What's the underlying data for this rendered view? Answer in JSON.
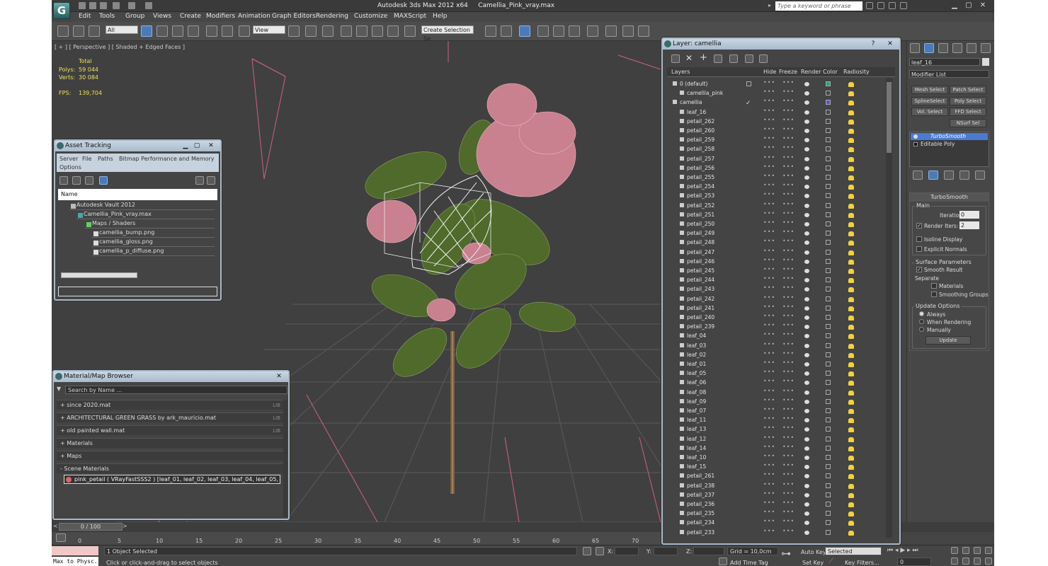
{
  "app": {
    "title": "Autodesk 3ds Max  2012 x64",
    "file": "Camellia_Pink_vray.max",
    "search_placeholder": "Type a keyword or phrase",
    "logo": "G"
  },
  "menu": [
    "Edit",
    "Tools",
    "Group",
    "Views",
    "Create",
    "Modifiers",
    "Animation",
    "Graph Editors",
    "Rendering",
    "Customize",
    "MAXScript",
    "Help"
  ],
  "toolbar": {
    "filter": "All",
    "refcoord": "View",
    "selset": "Create Selection Se"
  },
  "viewport": {
    "label": "[ + ] [ Perspective ] [ Shaded + Edged Faces ]",
    "stats": {
      "total": "Total",
      "polys_label": "Polys:",
      "polys": "59 044",
      "verts_label": "Verts:",
      "verts": "30 084",
      "fps_label": "FPS:",
      "fps": "139,704"
    }
  },
  "asset_tracking": {
    "title": "Asset Tracking",
    "menu": [
      "Server",
      "File",
      "Paths",
      "Bitmap Performance and Memory"
    ],
    "menu2": "Options",
    "column": "Name",
    "rows": [
      "Autodesk Vault 2012",
      "Camellia_Pink_vray.max",
      "Maps / Shaders",
      "camellia_bump.png",
      "camellia_gloss.png",
      "camellia_p_diffuse.png"
    ]
  },
  "material_browser": {
    "title": "Material/Map Browser",
    "search": "Search by Name ...",
    "items": [
      {
        "label": "+ since 2020.mat",
        "tag": "LIB"
      },
      {
        "label": "+ ARCHITECTURAL GREEN GRASS by ark_mauricio.mat",
        "tag": "LIB"
      },
      {
        "label": "+ old painted wall.mat",
        "tag": "LIB"
      },
      {
        "label": "+ Materials",
        "tag": ""
      },
      {
        "label": "+ Maps",
        "tag": ""
      },
      {
        "label": "- Scene Materials",
        "tag": ""
      }
    ],
    "material": "pink_petail  ( VRayFastSSS2 )  [leaf_01, leaf_02, leaf_03, leaf_04, leaf_05, leaf_0..."
  },
  "layer_manager": {
    "title": "Layer: camellia",
    "columns": [
      "Layers",
      "Hide",
      "Freeze",
      "Render",
      "Color",
      "Radiosity"
    ],
    "layers": [
      {
        "name": "0 (default)",
        "indent": 0,
        "color": "#1fa87a"
      },
      {
        "name": "camellia_pink",
        "indent": 1,
        "color": ""
      },
      {
        "name": "camellia",
        "indent": 0,
        "color": "#5555dd"
      },
      {
        "name": "leaf_16",
        "indent": 1
      },
      {
        "name": "petail_262",
        "indent": 1
      },
      {
        "name": "petail_260",
        "indent": 1
      },
      {
        "name": "petail_259",
        "indent": 1
      },
      {
        "name": "petail_258",
        "indent": 1
      },
      {
        "name": "petail_257",
        "indent": 1
      },
      {
        "name": "petail_256",
        "indent": 1
      },
      {
        "name": "petail_255",
        "indent": 1
      },
      {
        "name": "petail_254",
        "indent": 1
      },
      {
        "name": "petail_253",
        "indent": 1
      },
      {
        "name": "petail_252",
        "indent": 1
      },
      {
        "name": "petail_251",
        "indent": 1
      },
      {
        "name": "petail_250",
        "indent": 1
      },
      {
        "name": "petail_249",
        "indent": 1
      },
      {
        "name": "petail_248",
        "indent": 1
      },
      {
        "name": "petail_247",
        "indent": 1
      },
      {
        "name": "petail_246",
        "indent": 1
      },
      {
        "name": "petail_245",
        "indent": 1
      },
      {
        "name": "petail_244",
        "indent": 1
      },
      {
        "name": "petail_243",
        "indent": 1
      },
      {
        "name": "petail_242",
        "indent": 1
      },
      {
        "name": "petail_241",
        "indent": 1
      },
      {
        "name": "petail_240",
        "indent": 1
      },
      {
        "name": "petail_239",
        "indent": 1
      },
      {
        "name": "leaf_04",
        "indent": 1
      },
      {
        "name": "leaf_03",
        "indent": 1
      },
      {
        "name": "leaf_02",
        "indent": 1
      },
      {
        "name": "leaf_01",
        "indent": 1
      },
      {
        "name": "leaf_05",
        "indent": 1
      },
      {
        "name": "leaf_06",
        "indent": 1
      },
      {
        "name": "leaf_08",
        "indent": 1
      },
      {
        "name": "leaf_09",
        "indent": 1
      },
      {
        "name": "leaf_07",
        "indent": 1
      },
      {
        "name": "leaf_11",
        "indent": 1
      },
      {
        "name": "leaf_13",
        "indent": 1
      },
      {
        "name": "leaf_12",
        "indent": 1
      },
      {
        "name": "leaf_14",
        "indent": 1
      },
      {
        "name": "leaf_10",
        "indent": 1
      },
      {
        "name": "leaf_15",
        "indent": 1
      },
      {
        "name": "petail_261",
        "indent": 1
      },
      {
        "name": "petail_238",
        "indent": 1
      },
      {
        "name": "petail_237",
        "indent": 1
      },
      {
        "name": "petail_236",
        "indent": 1
      },
      {
        "name": "petail_235",
        "indent": 1
      },
      {
        "name": "petail_234",
        "indent": 1
      },
      {
        "name": "petail_233",
        "indent": 1
      }
    ]
  },
  "command_panel": {
    "object_name": "leaf_16",
    "modifier_list": "Modifier List",
    "buttons": [
      "Mesh Select",
      "Patch Select",
      "SplineSelect",
      "Poly Select",
      "Vol. Select",
      "FFD Select",
      "NSurf Sel"
    ],
    "stack": [
      "TurboSmooth",
      "Editable Poly"
    ],
    "turbosmooth": {
      "title": "TurboSmooth",
      "main": "Main",
      "iterations_label": "Iterations:",
      "iterations": "0",
      "render_iters_label": "Render Iters:",
      "render_iters": "2",
      "isoline": "Isoline Display",
      "explicit": "Explicit Normals",
      "surface": "Surface Parameters",
      "smooth": "Smooth Result",
      "separate": "Separate",
      "materials": "Materials",
      "smoothing": "Smoothing Groups",
      "update_options": "Update Options",
      "always": "Always",
      "when_rendering": "When Rendering",
      "manually": "Manually",
      "update": "Update"
    }
  },
  "timeline": {
    "frame": "0 / 100",
    "ticks": [
      "0",
      "5",
      "10",
      "15",
      "20",
      "25",
      "30",
      "35",
      "40",
      "45",
      "50",
      "55",
      "60",
      "65",
      "70"
    ]
  },
  "status": {
    "maxscript": "Max to Physc.",
    "selected": "1 Object Selected",
    "prompt": "Click or click-and-drag to select objects",
    "x": "X:",
    "y": "Y:",
    "z": "Z:",
    "grid": "Grid = 10,0cm",
    "addtime": "Add Time Tag",
    "autokey": "Auto Key",
    "setkey": "Set Key",
    "selected_dd": "Selected",
    "keyfilters": "Key Filters...",
    "frame": "0"
  }
}
